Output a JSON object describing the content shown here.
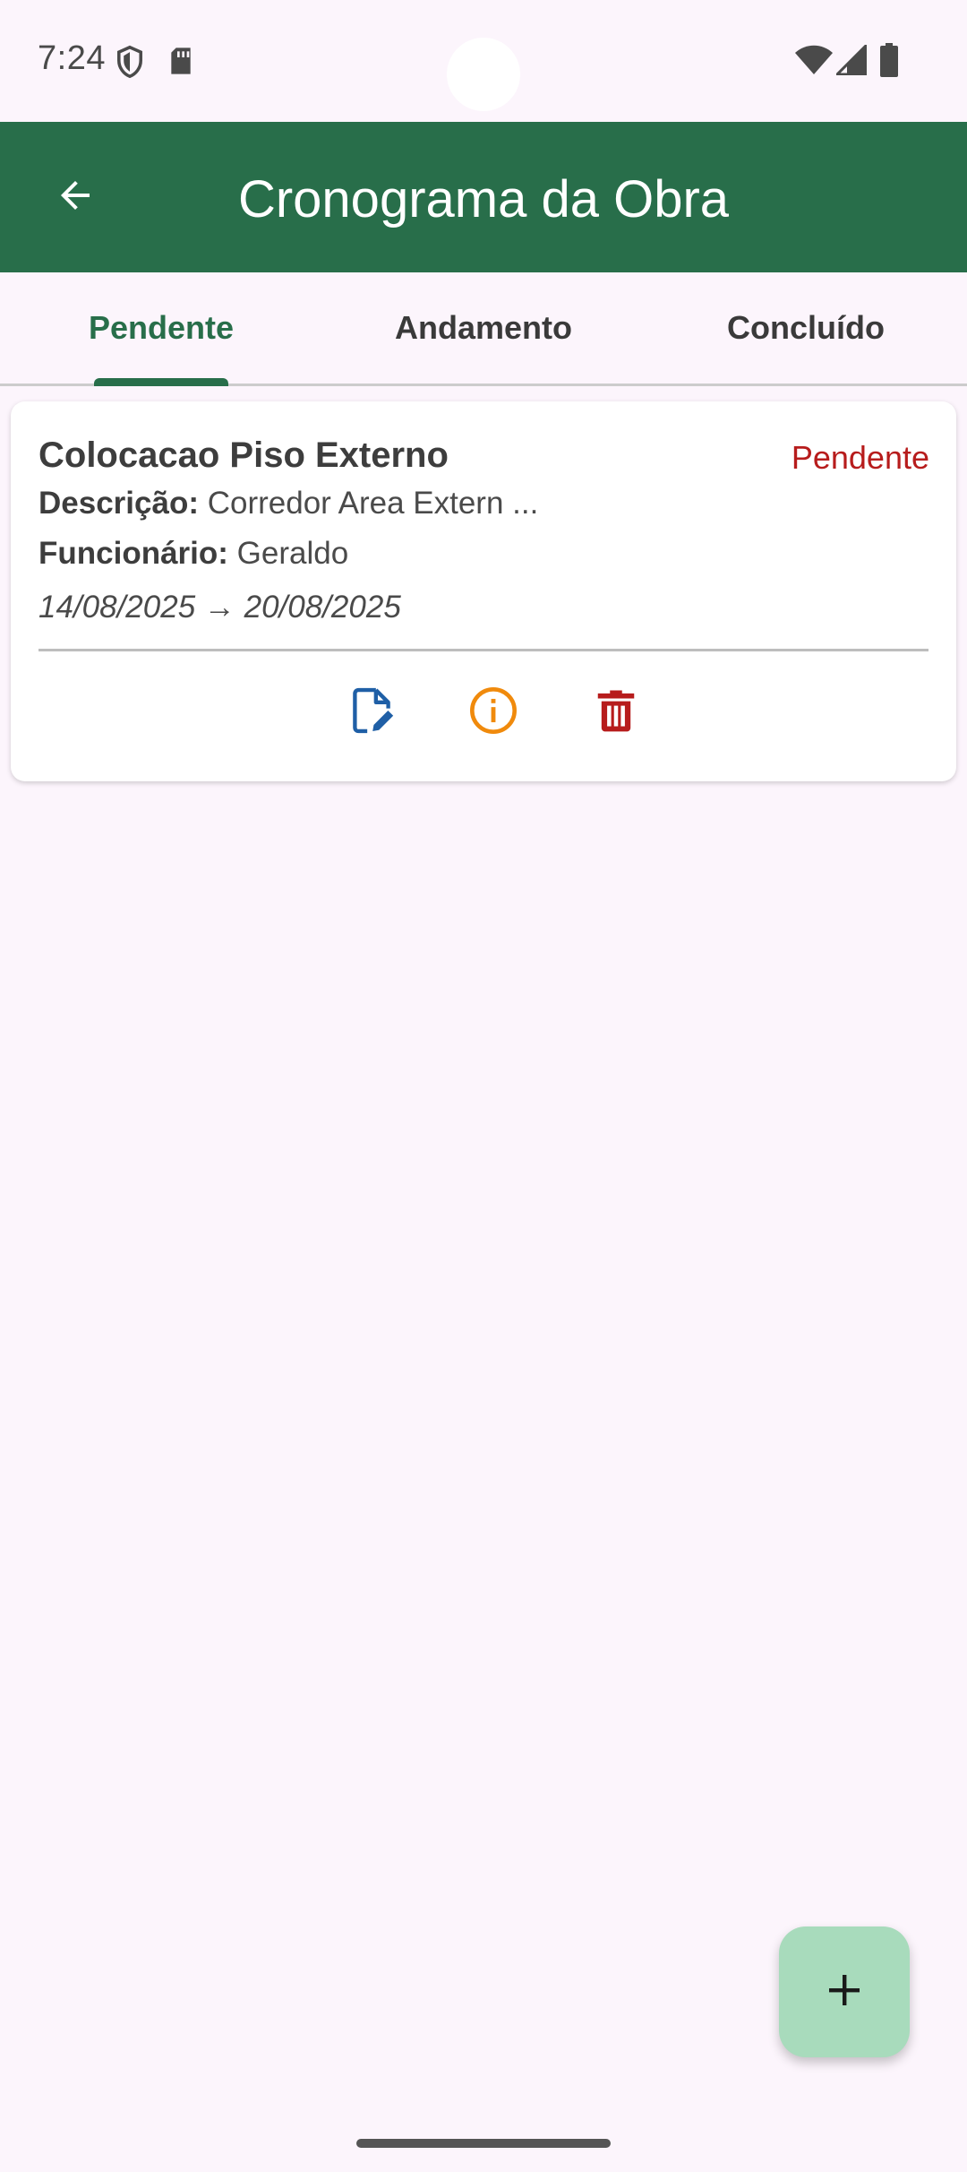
{
  "status_bar": {
    "time": "7:24",
    "icons": [
      "shield-icon",
      "sd-card-icon",
      "wifi-icon",
      "signal-icon",
      "battery-icon"
    ]
  },
  "app_bar": {
    "title": "Cronograma da Obra",
    "back_icon": "arrow-back-icon",
    "background": "#286E4A"
  },
  "tabs": [
    {
      "label": "Pendente",
      "active": true
    },
    {
      "label": "Andamento",
      "active": false
    },
    {
      "label": "Concluído",
      "active": false
    }
  ],
  "cards": [
    {
      "title": "Colocacao Piso Externo",
      "status": "Pendente",
      "description_label": "Descrição:",
      "description": "Corredor Area Extern ...",
      "employee_label": "Funcionário:",
      "employee": "Geraldo",
      "dates": "14/08/2025 → 20/08/2025",
      "actions": [
        {
          "icon": "edit-document-icon",
          "color": "#1F5FA6"
        },
        {
          "icon": "info-icon",
          "color": "#F08A0C"
        },
        {
          "icon": "delete-icon",
          "color": "#B71C1C"
        }
      ]
    }
  ],
  "fab": {
    "icon": "add-icon",
    "color": "#A8DBBC"
  },
  "colors": {
    "accent": "#286E4A",
    "status_pending": "#B71C1C",
    "background": "#FCF5FC"
  }
}
